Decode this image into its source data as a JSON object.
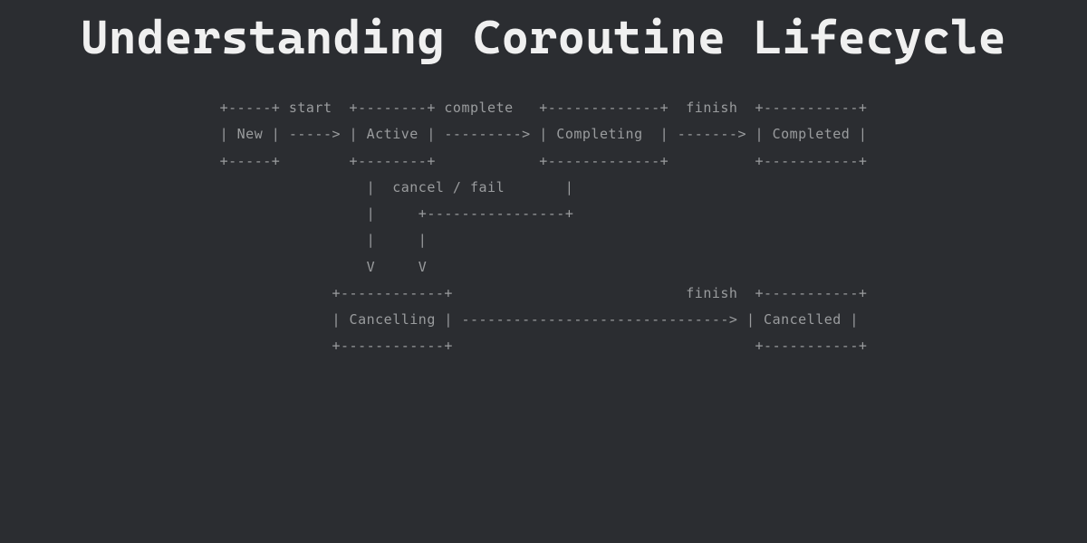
{
  "title": "Understanding Coroutine\nLifecycle",
  "diagram": "+-----+ start  +--------+ complete   +-------------+  finish  +-----------+\n| New | -----> | Active | ---------> | Completing  | -------> | Completed |\n+-----+        +--------+            +-------------+          +-----------+\n                 |  cancel / fail       |\n                 |     +----------------+\n                 |     |\n                 V     V\n             +------------+                           finish  +-----------+\n             | Cancelling | -------------------------------> | Cancelled |\n             +------------+                                   +-----------+",
  "states": [
    "New",
    "Active",
    "Completing",
    "Completed",
    "Cancelling",
    "Cancelled"
  ],
  "transitions": [
    {
      "from": "New",
      "to": "Active",
      "label": "start"
    },
    {
      "from": "Active",
      "to": "Completing",
      "label": "complete"
    },
    {
      "from": "Completing",
      "to": "Completed",
      "label": "finish"
    },
    {
      "from": "Active",
      "to": "Cancelling",
      "label": "cancel / fail"
    },
    {
      "from": "Completing",
      "to": "Cancelling",
      "label": "cancel / fail"
    },
    {
      "from": "Cancelling",
      "to": "Cancelled",
      "label": "finish"
    }
  ],
  "colors": {
    "background": "#2b2d31",
    "title": "#f0f0f0",
    "diagram": "#9a9c9e"
  }
}
